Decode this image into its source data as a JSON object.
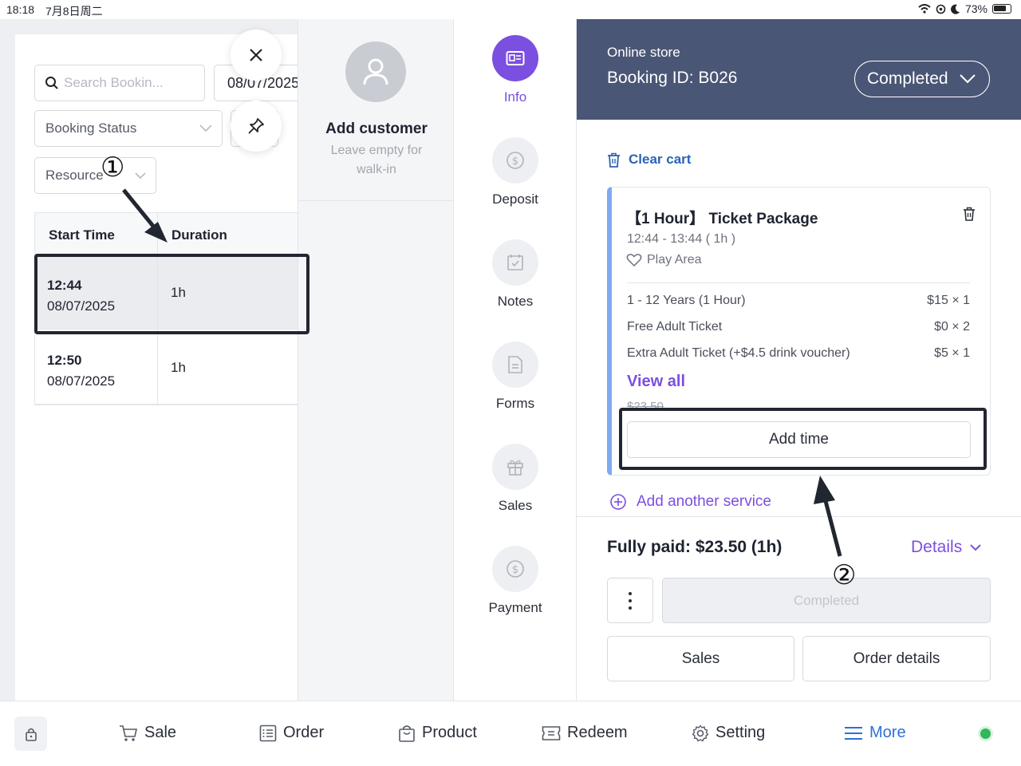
{
  "status_bar": {
    "time": "18:18",
    "date": "7月8日周二",
    "battery": "73%"
  },
  "filters": {
    "search_placeholder": "Search Bookin...",
    "date_value": "08/07/2025",
    "booking_status": "Booking Status",
    "resource": "Resource"
  },
  "table": {
    "headers": [
      "Start Time",
      "Duration"
    ],
    "rows": [
      {
        "time": "12:44",
        "date": "08/07/2025",
        "duration": "1h"
      },
      {
        "time": "12:50",
        "date": "08/07/2025",
        "duration": "1h"
      }
    ]
  },
  "customer": {
    "title": "Add customer",
    "subtitle": "Leave empty for walk-in"
  },
  "nav": [
    {
      "label": "Info",
      "icon": "id-card-icon"
    },
    {
      "label": "Deposit",
      "icon": "dollar-coin-icon"
    },
    {
      "label": "Notes",
      "icon": "calendar-check-icon"
    },
    {
      "label": "Forms",
      "icon": "document-icon"
    },
    {
      "label": "Sales",
      "icon": "gift-icon"
    },
    {
      "label": "Payment",
      "icon": "dollar-coin-icon"
    }
  ],
  "detail": {
    "store": "Online store",
    "booking_id": "Booking ID: B026",
    "status": "Completed",
    "clear_cart": "Clear cart",
    "item": {
      "title": "【1 Hour】 Ticket Package",
      "time": "12:44 - 13:44 ( 1h )",
      "area": "Play Area",
      "lines": [
        {
          "name": "1 - 12 Years (1 Hour)",
          "price": "$15 × 1"
        },
        {
          "name": "Free Adult Ticket",
          "price": "$0 × 2"
        },
        {
          "name": "Extra Adult Ticket (+$4.5 drink voucher)",
          "price": "$5 × 1"
        }
      ],
      "view_all": "View all",
      "old_price": "$23.50",
      "add_time": "Add time"
    },
    "add_service": "Add another service",
    "paid": "Fully paid: $23.50 (1h)",
    "details": "Details",
    "completed_button": "Completed",
    "sales_button": "Sales",
    "order_details_button": "Order details"
  },
  "tabs": [
    {
      "label": "Sale",
      "icon": "cart-icon"
    },
    {
      "label": "Order",
      "icon": "list-icon"
    },
    {
      "label": "Product",
      "icon": "bag-icon"
    },
    {
      "label": "Redeem",
      "icon": "ticket-icon"
    },
    {
      "label": "Setting",
      "icon": "gear-icon"
    },
    {
      "label": "More",
      "icon": "menu-icon"
    }
  ],
  "annotations": {
    "one": "①",
    "two": "②"
  },
  "colors": {
    "accent": "#7b4fe0",
    "header_bg": "#4a5675",
    "link_blue": "#2a62b8",
    "tab_active": "#2f6fdc",
    "online": "#2fb858"
  }
}
